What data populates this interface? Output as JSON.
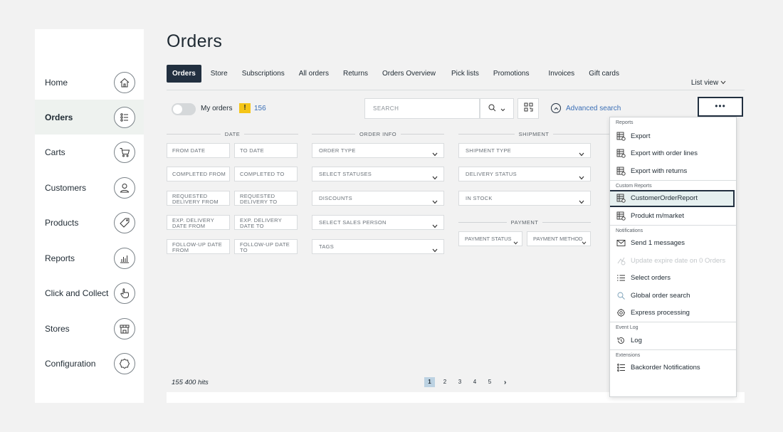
{
  "sidebar": {
    "items": [
      {
        "label": "Home",
        "icon": "home-icon"
      },
      {
        "label": "Orders",
        "icon": "list-icon",
        "active": true
      },
      {
        "label": "Carts",
        "icon": "cart-icon"
      },
      {
        "label": "Customers",
        "icon": "user-icon"
      },
      {
        "label": "Products",
        "icon": "tag-icon"
      },
      {
        "label": "Reports",
        "icon": "bar-chart-icon"
      },
      {
        "label": "Click and Collect",
        "icon": "pointer-hand-icon"
      },
      {
        "label": "Stores",
        "icon": "store-icon"
      },
      {
        "label": "Configuration",
        "icon": "gear-icon"
      }
    ]
  },
  "page": {
    "title": "Orders"
  },
  "tabs": [
    "Orders",
    "Store",
    "Subscriptions",
    "All orders",
    "Returns",
    "Orders Overview",
    "Pick lists",
    "Promotions",
    "Invoices",
    "Gift cards"
  ],
  "list_view": "List view",
  "my_orders": {
    "label": "My orders",
    "warning": "!",
    "count": "156"
  },
  "search": {
    "placeholder": "SEARCH"
  },
  "advanced_search": "Advanced search",
  "more_button": "•••",
  "groups": {
    "date": "DATE",
    "order_info": "ORDER INFO",
    "shipment": "SHIPMENT",
    "payment": "PAYMENT"
  },
  "date_fields": {
    "from_date": "FROM DATE",
    "to_date": "TO DATE",
    "completed_from": "COMPLETED FROM",
    "completed_to": "COMPLETED TO",
    "requested_from": "REQUESTED DELIVERY FROM",
    "requested_to": "REQUESTED DELIVERY TO",
    "exp_from": "EXP. DELIVERY DATE FROM",
    "exp_to": "EXP. DELIVERY DATE TO",
    "followup_from": "FOLLOW-UP DATE FROM",
    "followup_to": "FOLLOW-UP DATE TO"
  },
  "order_fields": {
    "order_type": "ORDER TYPE",
    "statuses": "SELECT STATUSES",
    "discounts": "DISCOUNTS",
    "sales_person": "SELECT SALES PERSON",
    "tags": "TAGS"
  },
  "shipment_fields": {
    "shipment_type": "SHIPMENT TYPE",
    "delivery_status": "DELIVERY STATUS",
    "in_stock": "IN STOCK"
  },
  "payment_fields": {
    "payment_status": "PAYMENT STATUS",
    "payment_method": "PAYMENT METHOD"
  },
  "results": {
    "hits": "155 400 hits"
  },
  "pagination": {
    "pages": [
      "1",
      "2",
      "3",
      "4",
      "5"
    ],
    "current": "1",
    "next": "›"
  },
  "menu": {
    "sections": {
      "reports": "Reports",
      "custom_reports": "Custom Reports",
      "notifications": "Notifications",
      "event_log": "Event Log",
      "extensions": "Extensions"
    },
    "items": {
      "export": "Export",
      "export_order_lines": "Export with order lines",
      "export_returns": "Export with returns",
      "customer_order_report": "CustomerOrderReport",
      "produkt_market": "Produkt m/market",
      "send_messages": "Send 1 messages",
      "update_expire": "Update expire date on 0 Orders",
      "select_orders": "Select orders",
      "global_search": "Global order search",
      "express_processing": "Express processing",
      "log": "Log",
      "backorder": "Backorder Notifications"
    }
  },
  "colors": {
    "accent_dark": "#223040",
    "link_blue": "#3b6fb6",
    "warning_yellow": "#f5c518",
    "selected_bg": "#e6f0f0"
  }
}
